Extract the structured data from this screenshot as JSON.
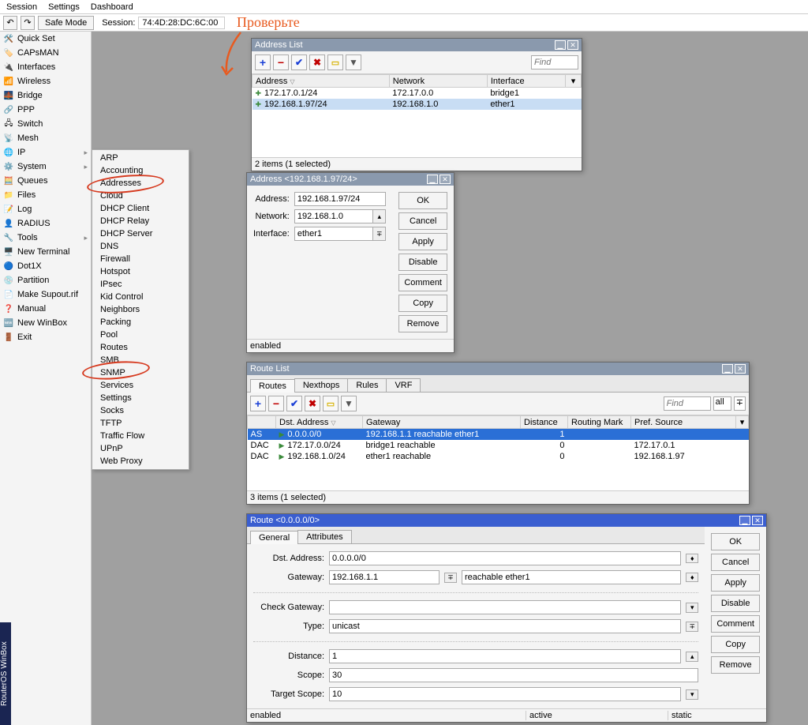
{
  "annotation": {
    "text": "Проверьте"
  },
  "menubar": {
    "items": [
      "Session",
      "Settings",
      "Dashboard"
    ]
  },
  "toolbar": {
    "safe_mode": "Safe Mode",
    "session_label": "Session:",
    "session_id": "74:4D:28:DC:6C:00"
  },
  "nav": {
    "items": [
      {
        "icon": "🛠️",
        "label": "Quick Set"
      },
      {
        "icon": "🏷️",
        "label": "CAPsMAN"
      },
      {
        "icon": "🔌",
        "label": "Interfaces"
      },
      {
        "icon": "📶",
        "label": "Wireless"
      },
      {
        "icon": "🌉",
        "label": "Bridge"
      },
      {
        "icon": "🔗",
        "label": "PPP"
      },
      {
        "icon": "🖧",
        "label": "Switch"
      },
      {
        "icon": "📡",
        "label": "Mesh"
      },
      {
        "icon": "🌐",
        "label": "IP",
        "sub": true
      },
      {
        "icon": "⚙️",
        "label": "System",
        "sub": true
      },
      {
        "icon": "🧮",
        "label": "Queues"
      },
      {
        "icon": "📁",
        "label": "Files"
      },
      {
        "icon": "📝",
        "label": "Log"
      },
      {
        "icon": "👤",
        "label": "RADIUS"
      },
      {
        "icon": "🔧",
        "label": "Tools",
        "sub": true
      },
      {
        "icon": "🖥️",
        "label": "New Terminal"
      },
      {
        "icon": "🔵",
        "label": "Dot1X"
      },
      {
        "icon": "💿",
        "label": "Partition"
      },
      {
        "icon": "📄",
        "label": "Make Supout.rif"
      },
      {
        "icon": "❓",
        "label": "Manual"
      },
      {
        "icon": "🆕",
        "label": "New WinBox"
      },
      {
        "icon": "🚪",
        "label": "Exit"
      }
    ]
  },
  "ip_submenu": [
    "ARP",
    "Accounting",
    "Addresses",
    "Cloud",
    "DHCP Client",
    "DHCP Relay",
    "DHCP Server",
    "DNS",
    "Firewall",
    "Hotspot",
    "IPsec",
    "Kid Control",
    "Neighbors",
    "Packing",
    "Pool",
    "Routes",
    "SMB",
    "SNMP",
    "Services",
    "Settings",
    "Socks",
    "TFTP",
    "Traffic Flow",
    "UPnP",
    "Web Proxy"
  ],
  "addr_list": {
    "title": "Address List",
    "find": "Find",
    "cols": [
      "Address",
      "Network",
      "Interface"
    ],
    "rows": [
      {
        "address": "172.17.0.1/24",
        "network": "172.17.0.0",
        "iface": "bridge1",
        "sel": false
      },
      {
        "address": "192.168.1.97/24",
        "network": "192.168.1.0",
        "iface": "ether1",
        "sel": true
      }
    ],
    "status": "2 items (1 selected)"
  },
  "addr_dlg": {
    "title": "Address <192.168.1.97/24>",
    "labels": {
      "address": "Address:",
      "network": "Network:",
      "interface": "Interface:"
    },
    "values": {
      "address": "192.168.1.97/24",
      "network": "192.168.1.0",
      "interface": "ether1"
    },
    "buttons": [
      "OK",
      "Cancel",
      "Apply",
      "Disable",
      "Comment",
      "Copy",
      "Remove"
    ],
    "status": "enabled"
  },
  "route_list": {
    "title": "Route List",
    "tabs": [
      "Routes",
      "Nexthops",
      "Rules",
      "VRF"
    ],
    "find": "Find",
    "filter_all": "all",
    "cols": [
      "",
      "Dst. Address",
      "Gateway",
      "Distance",
      "Routing Mark",
      "Pref. Source"
    ],
    "rows": [
      {
        "flag": "AS",
        "dst": "0.0.0.0/0",
        "gw": "192.168.1.1 reachable ether1",
        "dist": "1",
        "mark": "",
        "src": "",
        "sel": true
      },
      {
        "flag": "DAC",
        "dst": "172.17.0.0/24",
        "gw": "bridge1 reachable",
        "dist": "0",
        "mark": "",
        "src": "172.17.0.1"
      },
      {
        "flag": "DAC",
        "dst": "192.168.1.0/24",
        "gw": "ether1 reachable",
        "dist": "0",
        "mark": "",
        "src": "192.168.1.97"
      }
    ],
    "status": "3 items (1 selected)"
  },
  "route_dlg": {
    "title": "Route <0.0.0.0/0>",
    "tabs": [
      "General",
      "Attributes"
    ],
    "labels": {
      "dst": "Dst. Address:",
      "gw": "Gateway:",
      "check": "Check Gateway:",
      "type": "Type:",
      "dist": "Distance:",
      "scope": "Scope:",
      "tscope": "Target Scope:"
    },
    "values": {
      "dst": "0.0.0.0/0",
      "gw": "192.168.1.1",
      "gw_status": "reachable ether1",
      "check": "",
      "type": "unicast",
      "dist": "1",
      "scope": "30",
      "tscope": "10"
    },
    "buttons": [
      "OK",
      "Cancel",
      "Apply",
      "Disable",
      "Comment",
      "Copy",
      "Remove"
    ],
    "status": [
      "enabled",
      "active",
      "static"
    ]
  },
  "leftrail": "RouterOS WinBox"
}
